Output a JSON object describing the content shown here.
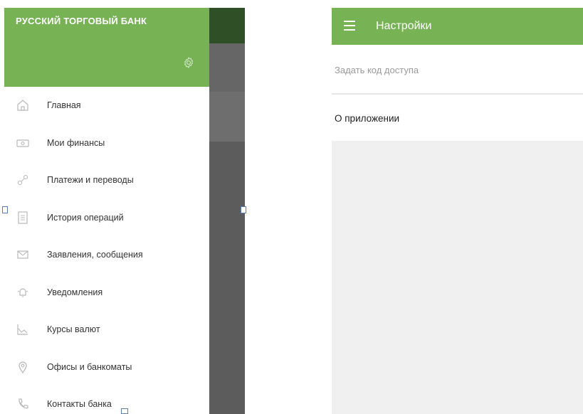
{
  "left": {
    "bank_name": "РУССКИЙ ТОРГОВЫЙ БАНК",
    "settings_icon": "gear-icon",
    "nav_items": [
      {
        "label": "Главная",
        "icon": "home-icon"
      },
      {
        "label": "Мои финансы",
        "icon": "wallet-icon"
      },
      {
        "label": "Платежи и переводы",
        "icon": "transfer-icon"
      },
      {
        "label": "История операций",
        "icon": "history-icon"
      },
      {
        "label": "Заявления, сообщения",
        "icon": "mail-icon"
      },
      {
        "label": "Уведомления",
        "icon": "notification-icon"
      },
      {
        "label": "Курсы валют",
        "icon": "chart-icon"
      },
      {
        "label": "Офисы и банкоматы",
        "icon": "location-pin-icon"
      },
      {
        "label": "Контакты банка",
        "icon": "phone-icon"
      }
    ]
  },
  "right": {
    "title": "Настройки",
    "menu_icon": "hamburger-menu-icon",
    "rows": [
      {
        "label": "Задать код доступа"
      },
      {
        "label": "О приложении"
      }
    ]
  },
  "colors": {
    "brand_green": "#77b255",
    "icon_gray": "#b8b8b8"
  }
}
